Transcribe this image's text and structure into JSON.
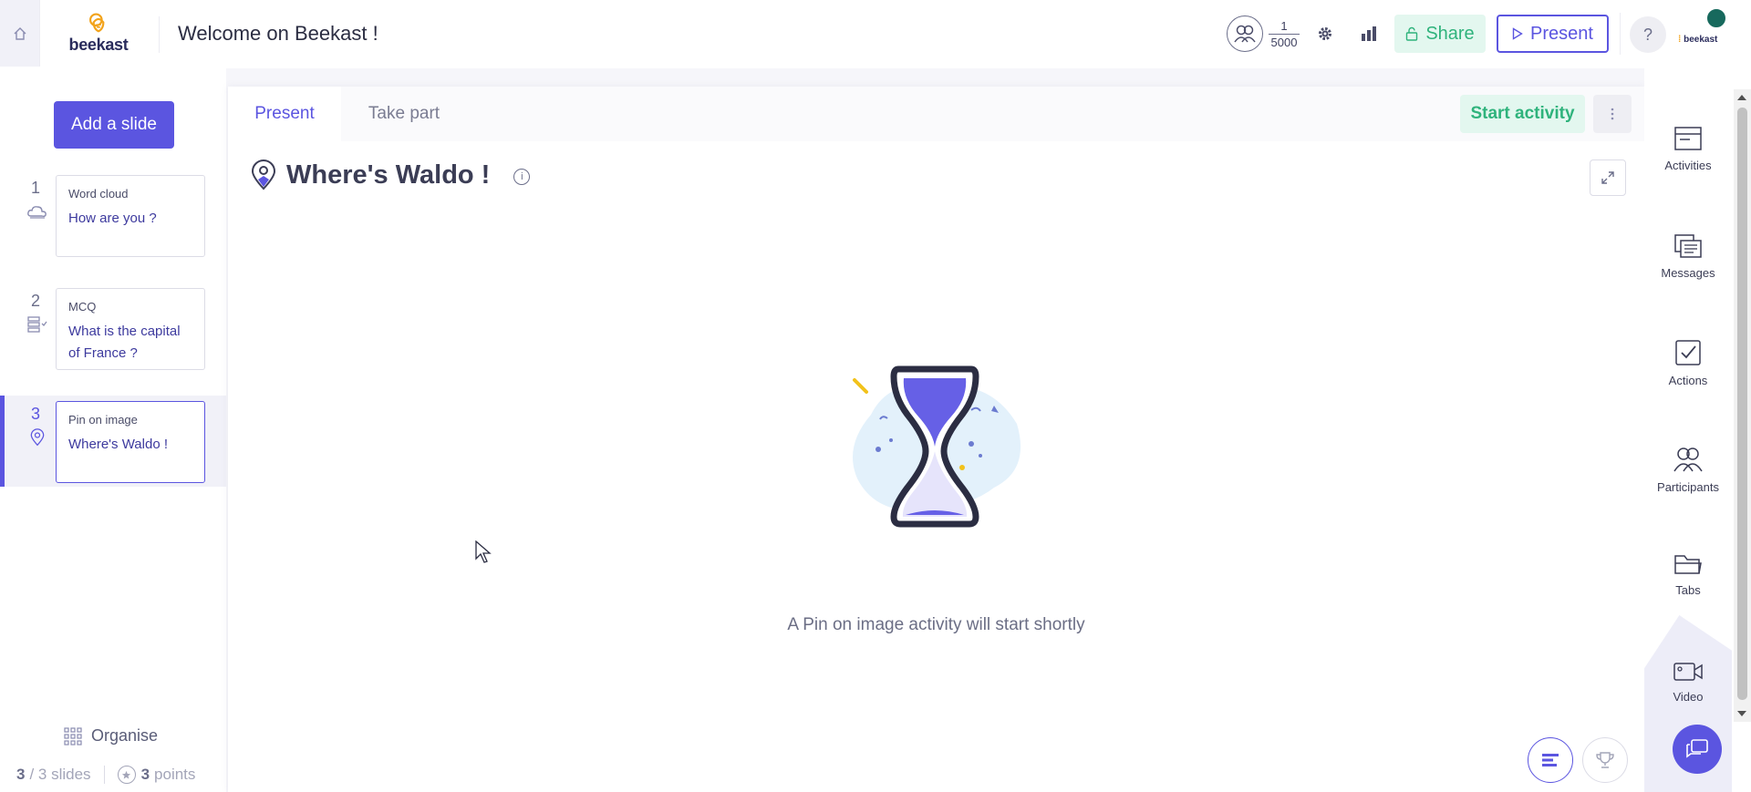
{
  "header": {
    "title": "Welcome on Beekast !",
    "logo_text": "beekast",
    "participants": {
      "current": "1",
      "max": "5000"
    },
    "share_label": "Share",
    "present_label": "Present",
    "help_label": "?",
    "account_brand": "beekast"
  },
  "left_sidebar": {
    "add_slide_label": "Add a slide",
    "slides": [
      {
        "number": "1",
        "type": "Word cloud",
        "text": "How are you ?",
        "icon": "cloud-icon"
      },
      {
        "number": "2",
        "type": "MCQ",
        "text": "What is the capital of France ?",
        "icon": "list-check-icon"
      },
      {
        "number": "3",
        "type": "Pin on image",
        "text": "Where's Waldo !",
        "icon": "pin-icon",
        "active": true
      }
    ],
    "organise_label": "Organise",
    "slide_count_current": "3",
    "slide_count_total": "/ 3 slides",
    "points_value": "3",
    "points_label": "points"
  },
  "main": {
    "tabs": [
      {
        "label": "Present",
        "active": true
      },
      {
        "label": "Take part",
        "active": false
      }
    ],
    "start_activity_label": "Start activity",
    "activity_title": "Where's Waldo !",
    "info_label": "i",
    "waiting_message": "A Pin on image activity will start shortly"
  },
  "right_sidebar": {
    "items": [
      {
        "label": "Activities",
        "icon": "activities-icon"
      },
      {
        "label": "Messages",
        "icon": "messages-icon"
      },
      {
        "label": "Actions",
        "icon": "actions-icon"
      },
      {
        "label": "Participants",
        "icon": "participants-icon"
      },
      {
        "label": "Tabs",
        "icon": "folder-icon"
      },
      {
        "label": "Video",
        "icon": "video-icon"
      }
    ]
  },
  "colors": {
    "accent": "#5b55e0",
    "success": "#2fb37c",
    "success_bg": "#e3f7ef",
    "logo_orange": "#f2a31b"
  }
}
